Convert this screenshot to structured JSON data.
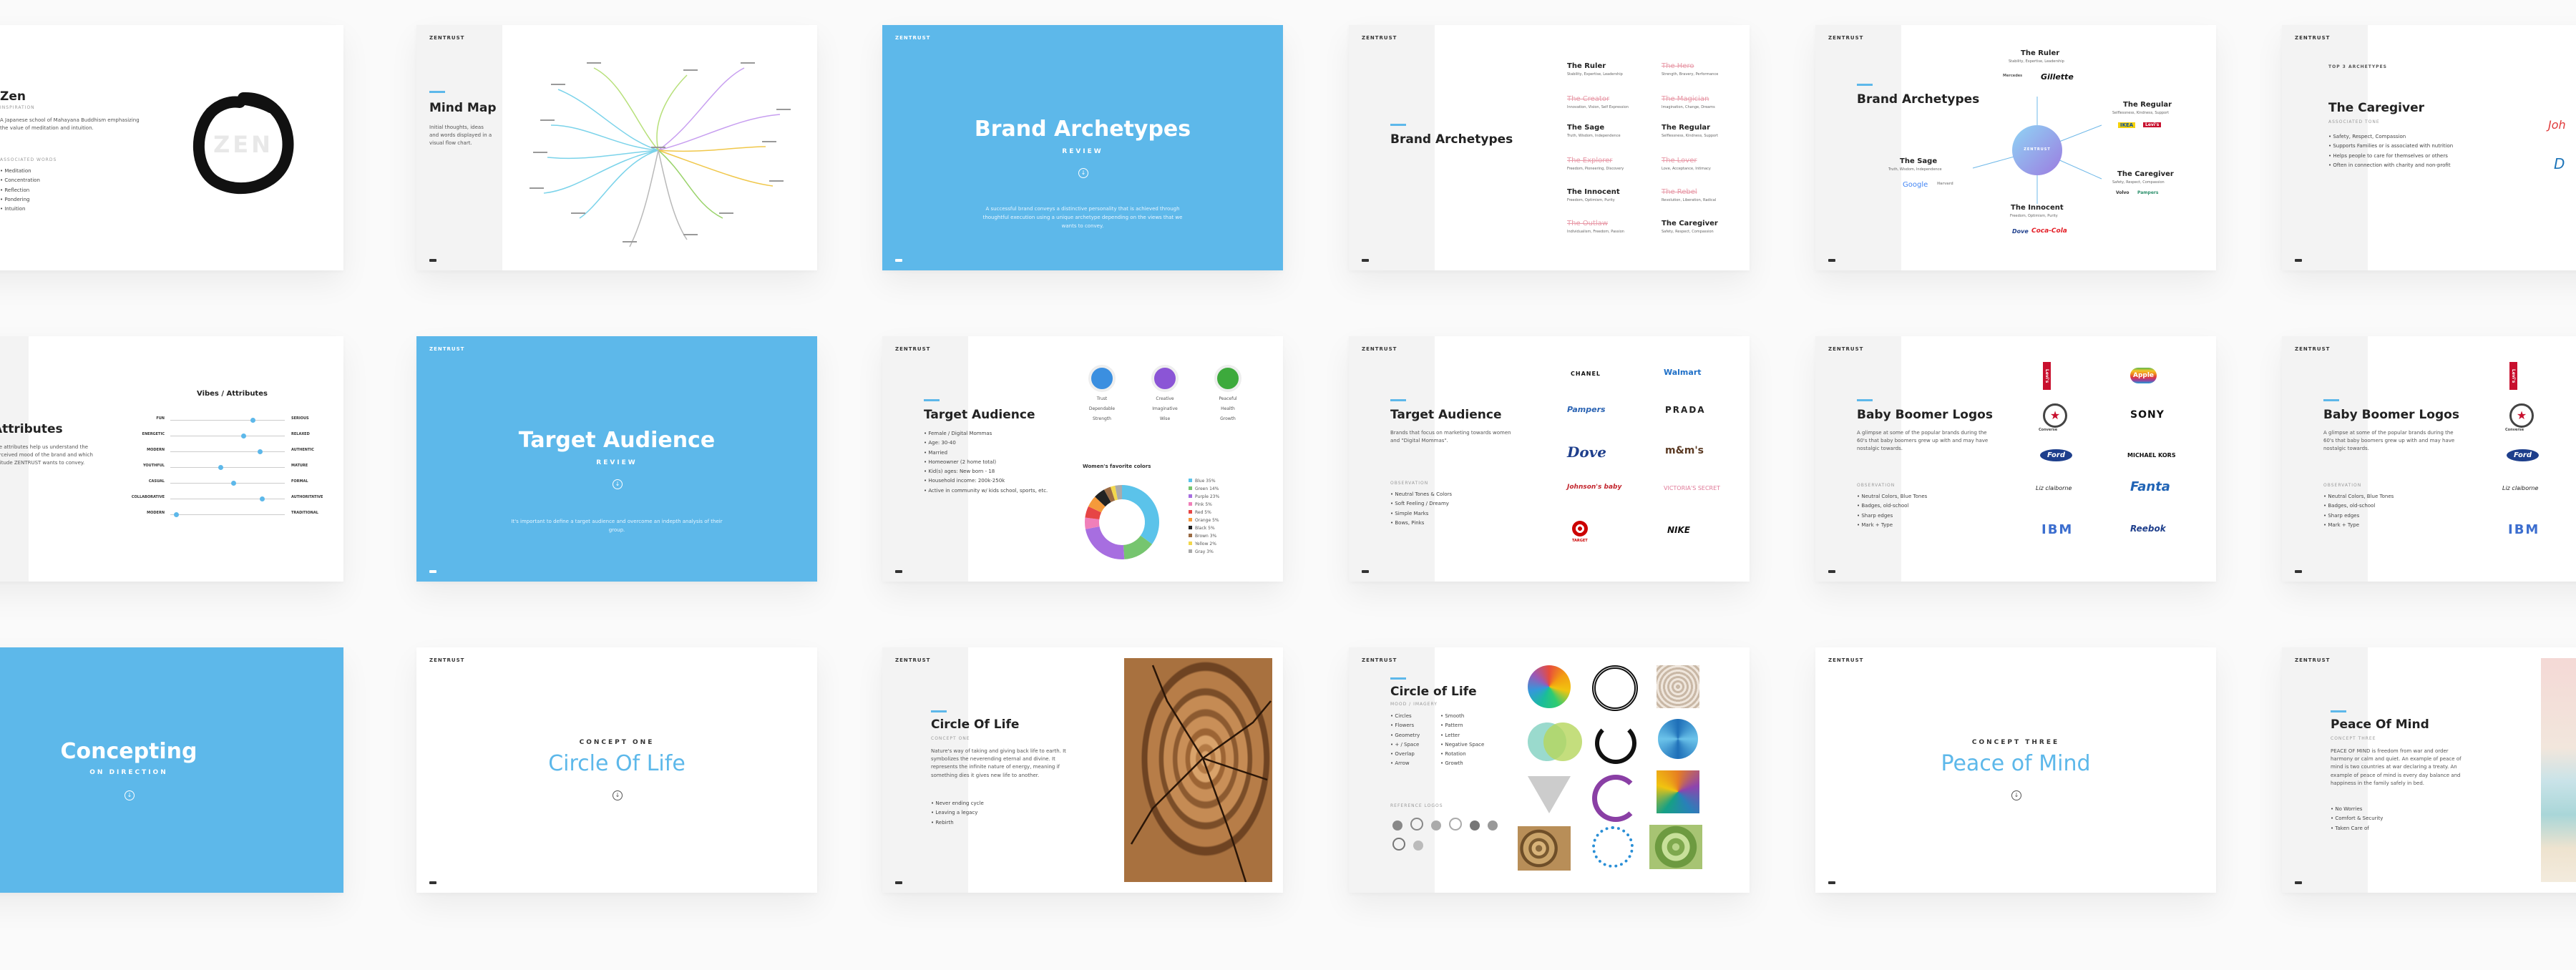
{
  "brand": "ZENTRUST",
  "zen": {
    "title": "Zen",
    "subtitle": "INSPIRATION",
    "body": "A Japanese school of Mahayana Buddhism emphasizing the value of meditation and intuition.",
    "bullets_heading": "ASSOCIATED WORDS",
    "bullets": [
      "Meditation",
      "Concentration",
      "Reflection",
      "Pondering",
      "Intuition"
    ],
    "watermark": "ZEN"
  },
  "mindmap": {
    "title": "Mind Map",
    "body": "Initial thoughts, ideas and words displayed in a visual flow chart."
  },
  "brand_archetypes_review": {
    "title": "Brand Archetypes",
    "subtitle": "REVIEW",
    "body": "A successful brand conveys a distinctive personality that is achieved through thoughtful execution using a unique archetype depending on the views that we wants to convey."
  },
  "archetype_list": {
    "title": "Brand Archetypes",
    "items": [
      {
        "name": "The Ruler",
        "desc": "Stability, Expertise, Leadership",
        "faded": false
      },
      {
        "name": "The Hero",
        "desc": "Strength, Bravery, Performance",
        "faded": true
      },
      {
        "name": "The Creator",
        "desc": "Innovation, Vision, Self Expression",
        "faded": true
      },
      {
        "name": "The Magician",
        "desc": "Imagination, Change, Dreams",
        "faded": true
      },
      {
        "name": "The Sage",
        "desc": "Truth, Wisdom, Independence",
        "faded": false
      },
      {
        "name": "The Regular",
        "desc": "Selflessness, Kindness, Support",
        "faded": false
      },
      {
        "name": "The Explorer",
        "desc": "Freedom, Pioneering, Discovery",
        "faded": true
      },
      {
        "name": "The Lover",
        "desc": "Love, Acceptance, Intimacy",
        "faded": true
      },
      {
        "name": "The Innocent",
        "desc": "Freedom, Optimism, Purity",
        "faded": false
      },
      {
        "name": "The Rebel",
        "desc": "Revolution, Liberation, Radical",
        "faded": true
      },
      {
        "name": "The Outlaw",
        "desc": "Individualism, Freedom, Passion",
        "faded": true
      },
      {
        "name": "The Caregiver",
        "desc": "Safety, Respect, Compassion",
        "faded": false
      }
    ]
  },
  "archetype_diagram": {
    "title": "Brand Archetypes",
    "center": "ZENTRUST",
    "nodes": [
      {
        "name": "The Ruler",
        "desc": "Stability, Expertise, Leadership",
        "logos": [
          "Mercedes",
          "Gillette"
        ]
      },
      {
        "name": "The Regular",
        "desc": "Selflessness, Kindness, Support",
        "logos": [
          "IKEA",
          "Levi's"
        ]
      },
      {
        "name": "The Caregiver",
        "desc": "Safety, Respect, Compassion",
        "logos": [
          "Volvo",
          "Pampers"
        ]
      },
      {
        "name": "The Innocent",
        "desc": "Freedom, Optimism, Purity",
        "logos": [
          "Dove",
          "Coca-Cola"
        ]
      },
      {
        "name": "The Sage",
        "desc": "Truth, Wisdom, Independence",
        "logos": [
          "Google",
          "Harvard"
        ]
      }
    ]
  },
  "caregiver": {
    "label": "TOP 3 ARCHETYPES",
    "title": "The Caregiver",
    "subtitle": "ASSOCIATED TONE",
    "bullets": [
      "Safety, Respect, Compassion",
      "Supports Families or is associated with nutrition",
      "Helps people to care for themselves or others",
      "Often in connection with charity and non-profit"
    ]
  },
  "vibes": {
    "title": "Vibes / Attributes",
    "side_title": "Attributes",
    "side_body": "The attributes help us understand the perceived mood of the brand and which attitude ZENTRUST wants to convey.",
    "rows": [
      {
        "left": "FUN",
        "right": "SERIOUS",
        "value": 0.72
      },
      {
        "left": "ENERGETIC",
        "right": "RELAXED",
        "value": 0.64
      },
      {
        "left": "MODERN",
        "right": "AUTHENTIC",
        "value": 0.78
      },
      {
        "left": "YOUTHFUL",
        "right": "MATURE",
        "value": 0.44
      },
      {
        "left": "CASUAL",
        "right": "FORMAL",
        "value": 0.55
      },
      {
        "left": "COLLABORATIVE",
        "right": "AUTHORITATIVE",
        "value": 0.8
      },
      {
        "left": "MODERN",
        "right": "TRADITIONAL",
        "value": 0.05
      }
    ]
  },
  "target_review": {
    "title": "Target Audience",
    "subtitle": "REVIEW",
    "body": "It's important to define a target audience and overcome an indepth analysis of their group."
  },
  "target_profile": {
    "title": "Target Audience",
    "bullets": [
      "Female / Digital Mommas",
      "Age: 30-40",
      "Married",
      "Homeowner (2 home total)",
      "Kid(s) ages: New born - 18",
      "Household income: 200k-250k",
      "Active in community w/ kids school, sports, etc."
    ],
    "swatches": [
      {
        "color": "#3b8fe0",
        "line1": "Trust",
        "line2": "Dependable",
        "line3": "Strength"
      },
      {
        "color": "#8b55d6",
        "line1": "Creative",
        "line2": "Imaginative",
        "line3": "Wise"
      },
      {
        "color": "#3daa3c",
        "line1": "Peaceful",
        "line2": "Health",
        "line3": "Growth"
      }
    ],
    "chart_title": "Women's favorite colors"
  },
  "chart_data": {
    "type": "pie",
    "title": "Women's favorite colors",
    "categories": [
      "Blue 35%",
      "Green 14%",
      "Purple 23%",
      "Pink 5%",
      "Red 5%",
      "Orange 5%",
      "Black 5%",
      "Brown 3%",
      "Yellow 2%",
      "Gray 3%"
    ],
    "values": [
      35,
      14,
      23,
      5,
      5,
      5,
      5,
      3,
      2,
      3
    ],
    "colors": [
      "#5bc3ea",
      "#76c56f",
      "#a76ee0",
      "#f07fb9",
      "#e64545",
      "#f59a3b",
      "#222222",
      "#9b6b43",
      "#f2d74c",
      "#aaaaaa"
    ]
  },
  "target_brands": {
    "title": "Target Audience",
    "body": "Brands that focus on marketing towards women and \"Digital Mommas\".",
    "heading": "OBSERVATION",
    "bullets": [
      "Neutral Tones & Colors",
      "Soft Feeling / Dreamy",
      "Simple Marks",
      "Bows, Pinks"
    ],
    "logos": [
      "CHANEL",
      "Walmart",
      "Pampers",
      "PRADA",
      "Dove",
      "m&m's",
      "Johnson's baby",
      "VICTORIA'S SECRET",
      "TARGET",
      "NIKE"
    ]
  },
  "boomer": {
    "title": "Baby Boomer Logos",
    "body": "A glimpse at some of the popular brands during the 60's that baby boomers grew up with and may have nostalgic towards.",
    "heading": "OBSERVATION",
    "bullets": [
      "Neutral Colors, Blue Tones",
      "Badges, old-school",
      "Sharp edges",
      "Mark + Type"
    ],
    "logos": [
      "Levi's",
      "Apple",
      "Converse",
      "SONY",
      "Ford",
      "MICHAEL KORS",
      "Liz claiborne",
      "Fanta",
      "IBM",
      "Reebok"
    ]
  },
  "boomer2": {
    "title": "Baby Boomer Logos",
    "body": "A glimpse at some of the popular brands during the 60's that baby boomers grew up with and may have nostalgic towards.",
    "heading": "OBSERVATION",
    "bullets": [
      "Neutral Colors, Blue Tones",
      "Badges, old-school",
      "Sharp edges",
      "Mark + Type"
    ],
    "logos": [
      "Levi's",
      "Converse",
      "Ford",
      "Liz claiborne",
      "IBM"
    ]
  },
  "concepting": {
    "title": "Concepting",
    "subtitle": "ON DIRECTION"
  },
  "concept_one": {
    "label": "CONCEPT ONE",
    "title": "Circle Of Life"
  },
  "circle_life": {
    "title": "Circle Of Life",
    "subtitle": "CONCEPT ONE",
    "body": "Nature's way of taking and giving back life to earth. It symbolizes the neverending eternal and divine. It represents the infinite nature of energy, meaning if something dies it gives new life to another.",
    "bullets": [
      "Never ending cycle",
      "Leaving a legacy",
      "Rebirth"
    ]
  },
  "circle_mood": {
    "title": "Circle of Life",
    "subtitle": "MOOD / IMAGERY",
    "col1": [
      "Circles",
      "Flowers",
      "Geometry",
      "+ / Space",
      "Overlap",
      "Arrow"
    ],
    "col2": [
      "Smooth",
      "Pattern",
      "Letter",
      "Negative Space",
      "Rotation",
      "Growth"
    ],
    "heading": "REFERENCE LOGOS"
  },
  "concept_three": {
    "label": "CONCEPT THREE",
    "title": "Peace of Mind"
  },
  "peace": {
    "title": "Peace Of Mind",
    "subtitle": "CONCEPT THREE",
    "body": "PEACE OF MIND is freedom from war and order harmony or calm and quiet. An example of peace of mind is two countries at war declaring a treaty. An example of peace of mind is every day balance and happiness in the family safely in bed.",
    "bullets": [
      "No Worries",
      "Comfort & Security",
      "Taken Care of"
    ]
  }
}
